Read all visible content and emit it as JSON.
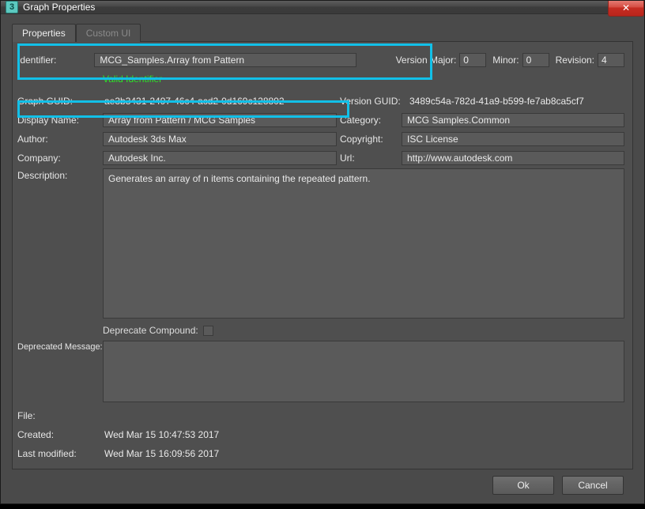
{
  "window": {
    "title": "Graph Properties"
  },
  "tabs": {
    "properties": "Properties",
    "custom_ui": "Custom UI"
  },
  "labels": {
    "identifier": "Identifier:",
    "version_major": "Version Major:",
    "minor": "Minor:",
    "revision": "Revision:",
    "valid_identifier": "Valid Identifier",
    "graph_guid": "Graph GUID:",
    "version_guid": "Version GUID:",
    "display_name": "Display Name:",
    "category": "Category:",
    "author": "Author:",
    "copyright": "Copyright:",
    "company": "Company:",
    "url": "Url:",
    "description": "Description:",
    "deprecate_compound": "Deprecate Compound:",
    "deprecated_message": "Deprecated Message:",
    "file": "File:",
    "created": "Created:",
    "last_modified": "Last modified:"
  },
  "values": {
    "identifier": "MCG_Samples.Array from Pattern",
    "version_major": "0",
    "version_minor": "0",
    "version_revision": "4",
    "graph_guid": "ae3b3431-2497-46c4-acd2-0d169c128802",
    "version_guid": "3489c54a-782d-41a9-b599-fe7ab8ca5cf7",
    "display_name": "Array from Pattern / MCG Samples",
    "category": "MCG Samples.Common",
    "author": "Autodesk 3ds Max",
    "copyright": "ISC License",
    "company": "Autodesk Inc.",
    "url": "http://www.autodesk.com",
    "description": "Generates an array of n items containing the repeated pattern.",
    "deprecate_compound": false,
    "deprecated_message": "",
    "file": "",
    "created": "Wed Mar 15 10:47:53 2017",
    "last_modified": "Wed Mar 15 16:09:56 2017"
  },
  "buttons": {
    "ok": "Ok",
    "cancel": "Cancel"
  }
}
